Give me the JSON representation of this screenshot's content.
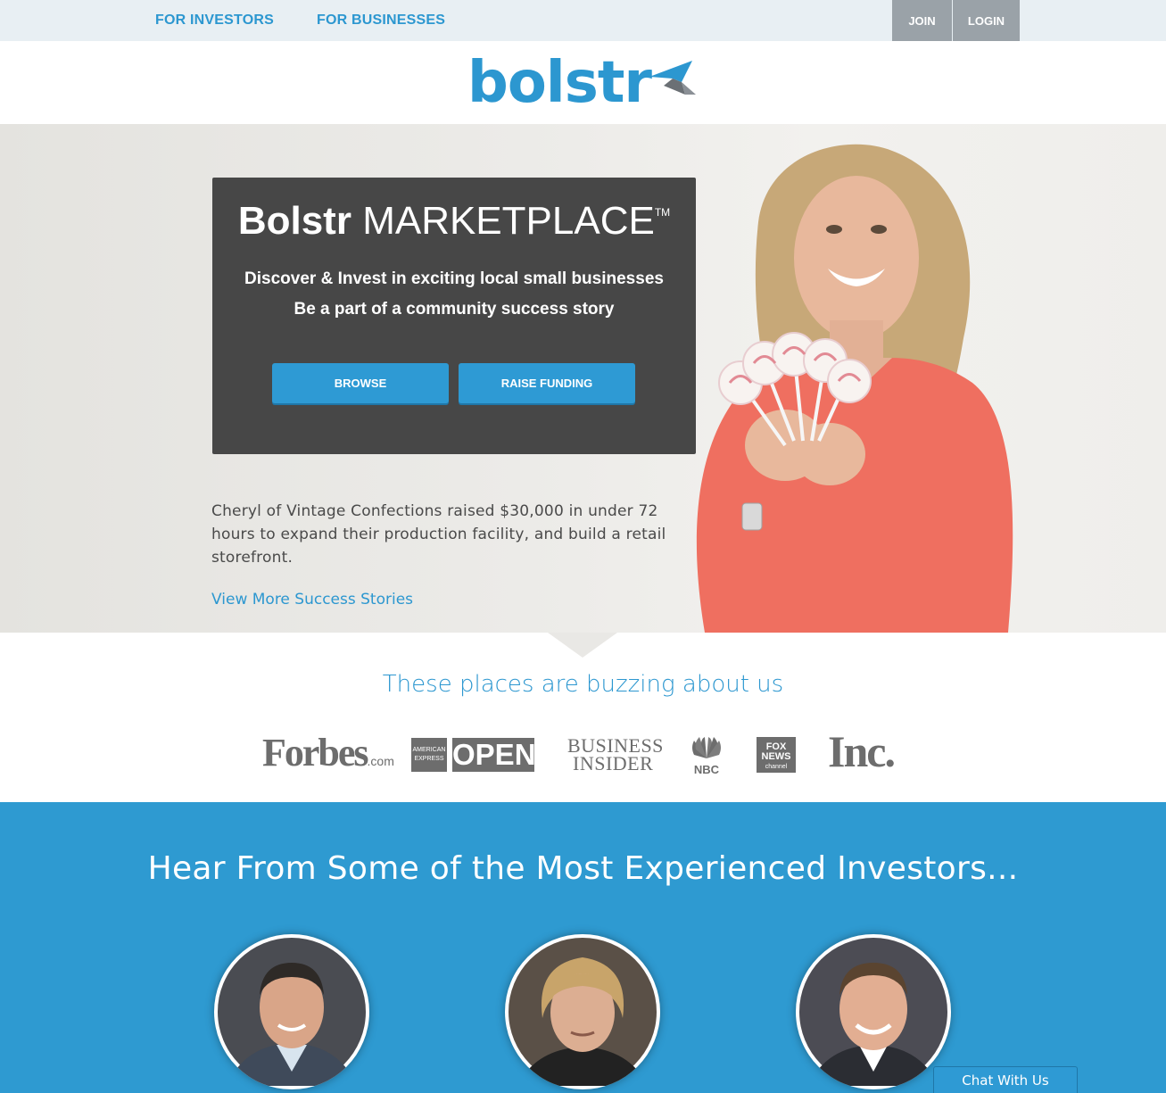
{
  "nav": {
    "for_investors": "FOR INVESTORS",
    "for_businesses": "FOR BUSINESSES",
    "join": "JOIN",
    "login": "LOGIN"
  },
  "brand": {
    "logo_text": "bolstr",
    "accent": "#2c97d0"
  },
  "hero": {
    "title_bold": "Bolstr",
    "title_light": "MARKETPLACE",
    "trademark": "TM",
    "line1": "Discover & Invest in exciting local small businesses",
    "line2": "Be a part of a community success story",
    "browse_label": "BROWSE",
    "raise_label": "RAISE FUNDING",
    "story": "Cheryl of Vintage Confections raised $30,000 in under 72 hours to expand their production facility, and build a retail storefront.",
    "more_link": "View More Success Stories"
  },
  "press": {
    "heading": "These places are buzzing about us",
    "forbes": "Forbes",
    "forbes_suffix": ".com",
    "amex": "AMERICAN EXPRESS",
    "open": "OPEN",
    "business_insider_1": "BUSINESS",
    "business_insider_2": "INSIDER",
    "nbc": "NBC",
    "fox_1": "FOX",
    "fox_2": "NEWS",
    "fox_3": "channel",
    "inc": "Inc."
  },
  "investors": {
    "heading": "Hear From Some of the Most Experienced Investors..."
  },
  "chat": {
    "label": "Chat With Us"
  }
}
